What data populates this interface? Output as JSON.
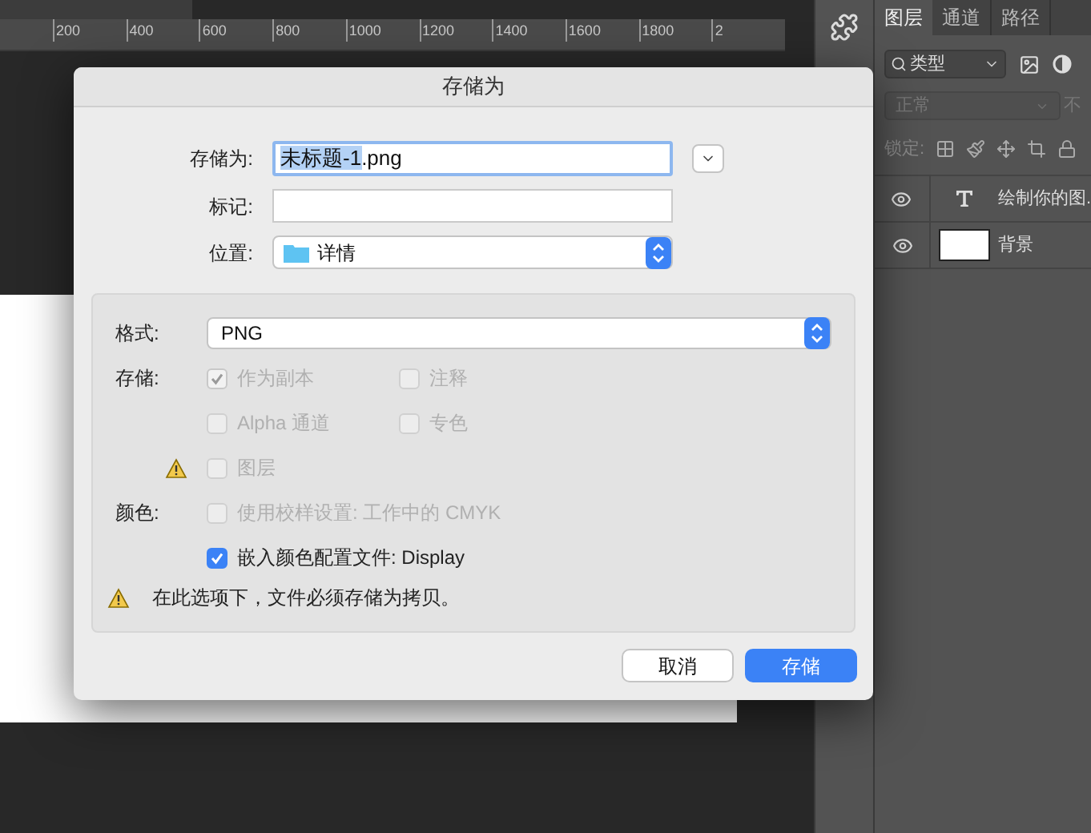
{
  "ruler": {
    "ticks": [
      "200",
      "400",
      "600",
      "800",
      "1000",
      "1200",
      "1400",
      "1600",
      "1800",
      "2"
    ]
  },
  "layers_panel": {
    "tabs": [
      {
        "label": "图层",
        "selected": true
      },
      {
        "label": "通道",
        "selected": false
      },
      {
        "label": "路径",
        "selected": false
      }
    ],
    "filter": {
      "value": "类型"
    },
    "blend_mode": {
      "value": "正常",
      "disabled": true
    },
    "opacity_label": "不",
    "lock_label": "锁定:",
    "layers": [
      {
        "kind": "text",
        "name": "绘制你的图.",
        "visible": true
      },
      {
        "kind": "image",
        "name": "背景",
        "visible": true
      }
    ]
  },
  "dialog": {
    "title": "存储为",
    "save_as": {
      "label": "存储为:",
      "value_selected": "未标题-1",
      "value_rest": ".png"
    },
    "tags": {
      "label": "标记:"
    },
    "location": {
      "label": "位置:",
      "value": "详情"
    },
    "format": {
      "label": "格式:",
      "value": "PNG"
    },
    "option_rows": [
      {
        "label": "存储:",
        "warning": false,
        "options": [
          {
            "label": "作为副本",
            "checked": true,
            "disabled": true
          },
          {
            "label": "注释",
            "checked": false,
            "disabled": true
          }
        ]
      },
      {
        "warning": false,
        "options": [
          {
            "label": "Alpha 通道",
            "checked": false,
            "disabled": true
          },
          {
            "label": "专色",
            "checked": false,
            "disabled": true
          }
        ]
      },
      {
        "warning": true,
        "options": [
          {
            "label": "图层",
            "checked": false,
            "disabled": true
          }
        ]
      },
      {
        "label": "颜色:",
        "warning": false,
        "options": [
          {
            "label": "使用校样设置: 工作中的 CMYK",
            "checked": false,
            "disabled": true
          }
        ]
      },
      {
        "warning": false,
        "options": [
          {
            "label": "嵌入颜色配置文件: Display",
            "checked": true,
            "disabled": false
          }
        ]
      }
    ],
    "note": "在此选项下，文件必须存储为拷贝。",
    "buttons": [
      {
        "label": "取消",
        "kind": "default"
      },
      {
        "label": "存储",
        "kind": "primary"
      }
    ]
  }
}
